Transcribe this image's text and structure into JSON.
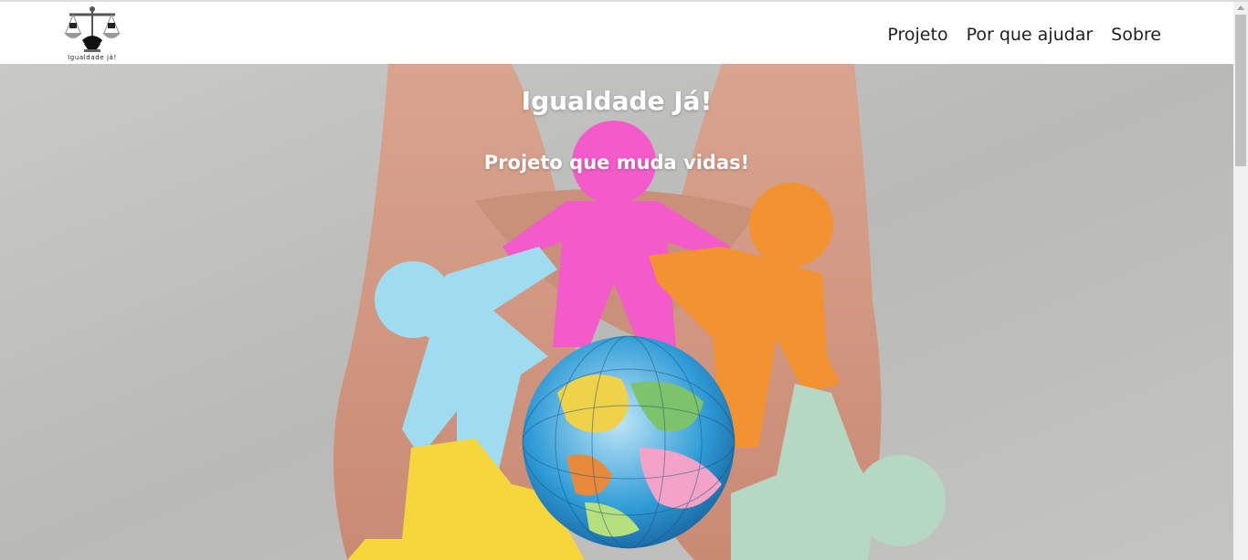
{
  "brand": {
    "logo_icon": "scales-of-justice-handshake-icon",
    "logo_text": "Igualdade já!"
  },
  "nav": {
    "items": [
      {
        "label": "Projeto"
      },
      {
        "label": "Por que ajudar"
      },
      {
        "label": "Sobre"
      }
    ]
  },
  "hero": {
    "title": "Igualdade Já!",
    "subtitle": "Projeto que muda vidas!",
    "image": "hands-holding-globe-with-paper-people-chain"
  },
  "colors": {
    "background_gray": "#bdbdbb",
    "pink": "#f25bc9",
    "orange": "#f39230",
    "blue": "#9fdcf0",
    "yellow": "#f6d63a",
    "mint": "#b5d8c3",
    "text_white": "#ffffff"
  }
}
